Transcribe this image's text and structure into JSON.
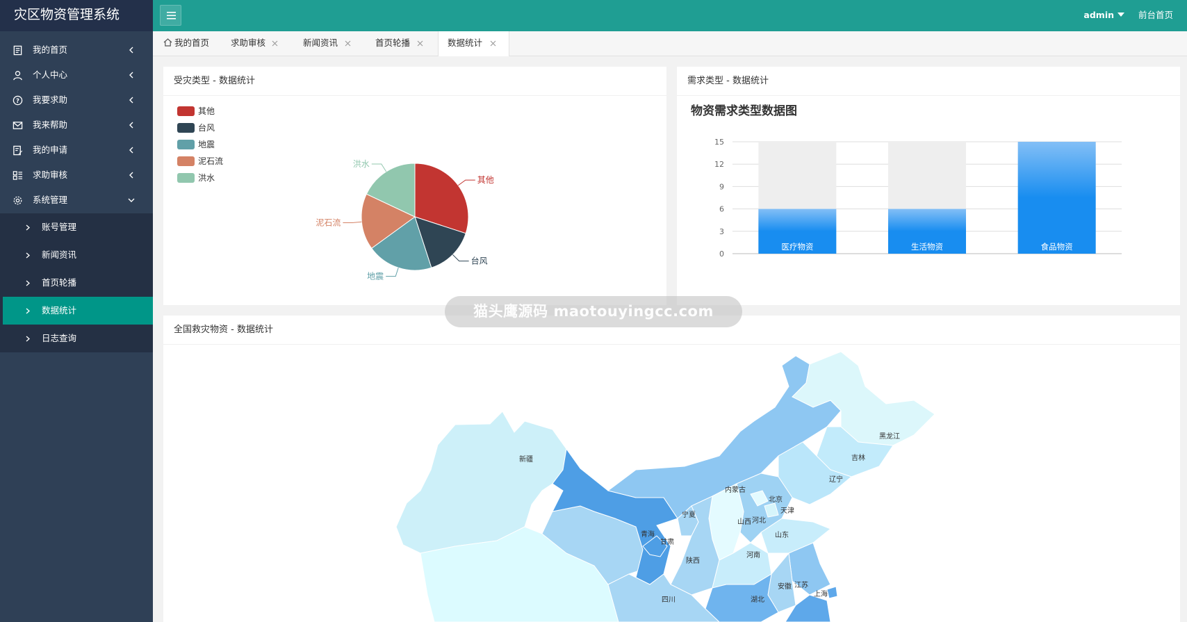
{
  "app": {
    "title": "灾区物资管理系统",
    "user": "admin",
    "front_link": "前台首页"
  },
  "sidebar": {
    "items": [
      {
        "label": "我的首页",
        "icon": "document-icon"
      },
      {
        "label": "个人中心",
        "icon": "user-icon"
      },
      {
        "label": "我要求助",
        "icon": "help-circle-icon"
      },
      {
        "label": "我来帮助",
        "icon": "mail-icon"
      },
      {
        "label": "我的申请",
        "icon": "edit-document-icon"
      },
      {
        "label": "求助审核",
        "icon": "list-icon"
      },
      {
        "label": "系统管理",
        "icon": "gear-icon"
      }
    ],
    "subitems": [
      {
        "label": "账号管理"
      },
      {
        "label": "新闻资讯"
      },
      {
        "label": "首页轮播"
      },
      {
        "label": "数据统计",
        "active": true
      },
      {
        "label": "日志查询"
      }
    ]
  },
  "tabs": [
    {
      "label": "我的首页"
    },
    {
      "label": "求助审核"
    },
    {
      "label": "新闻资讯"
    },
    {
      "label": "首页轮播"
    },
    {
      "label": "数据统计",
      "active": true
    }
  ],
  "cards": {
    "disaster": {
      "title": "受灾类型 - 数据统计"
    },
    "demand": {
      "title": "需求类型 - 数据统计"
    },
    "map": {
      "title": "全国救灾物资 - 数据统计"
    }
  },
  "watermark": "猫头鹰源码 maotouyingcc.com",
  "colors": {
    "header": "#1f9e93",
    "sidebar": "#2f4056",
    "active": "#009688",
    "bar": "#1c8ff0"
  },
  "chart_data": [
    {
      "type": "pie",
      "labels": [
        "其他",
        "台风",
        "地震",
        "泥石流",
        "洪水"
      ],
      "values": [
        30,
        15,
        20,
        17,
        18
      ],
      "colors": [
        "#c23531",
        "#2f4554",
        "#61a0a8",
        "#d48265",
        "#91c7ae"
      ],
      "legend_position": "top-left"
    },
    {
      "type": "bar",
      "title": "物资需求类型数据图",
      "categories": [
        "医疗物资",
        "生活物资",
        "食品物资"
      ],
      "values": [
        6,
        6,
        15
      ],
      "ylim": [
        0,
        15
      ],
      "yticks": [
        0,
        3,
        6,
        9,
        12,
        15
      ],
      "grid": true
    },
    {
      "type": "map",
      "region_labels": [
        "黑龙江",
        "吉林",
        "辽宁",
        "内蒙古",
        "北京",
        "天津",
        "河北",
        "山西",
        "山东",
        "河南",
        "宁夏",
        "甘肃",
        "青海",
        "陕西",
        "新疆",
        "四川",
        "湖北",
        "安徽",
        "江苏",
        "上海"
      ]
    }
  ]
}
